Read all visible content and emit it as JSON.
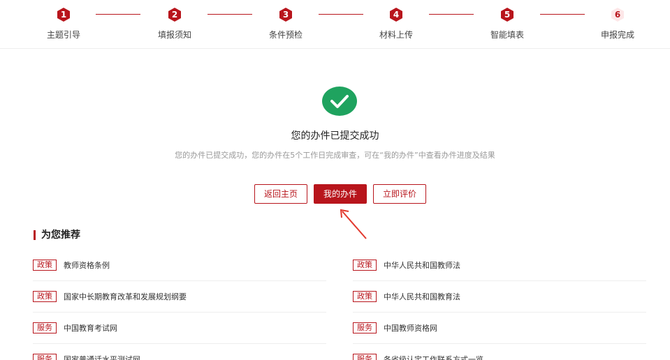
{
  "steps": [
    {
      "number": "1",
      "label": "主题引导"
    },
    {
      "number": "2",
      "label": "填报须知"
    },
    {
      "number": "3",
      "label": "条件预检"
    },
    {
      "number": "4",
      "label": "材料上传"
    },
    {
      "number": "5",
      "label": "智能填表"
    },
    {
      "number": "6",
      "label": "申报完成"
    }
  ],
  "success": {
    "icon": "check-circle-icon",
    "title": "您的办件已提交成功",
    "description": "您的办件已提交成功，您的办件在5个工作日完成审查，可在“我的办件”中查看办件进度及结果"
  },
  "buttons": {
    "home": "返回主页",
    "my_items": "我的办件",
    "evaluate": "立即评价"
  },
  "recommend": {
    "title": "为您推荐",
    "left": [
      {
        "tag": "政策",
        "text": "教师资格条例"
      },
      {
        "tag": "政策",
        "text": "国家中长期教育改革和发展规划纲要"
      },
      {
        "tag": "服务",
        "text": "中国教育考试网"
      },
      {
        "tag": "服务",
        "text": "国家普通话水平测试网"
      }
    ],
    "right": [
      {
        "tag": "政策",
        "text": "中华人民共和国教师法"
      },
      {
        "tag": "政策",
        "text": "中华人民共和国教育法"
      },
      {
        "tag": "服务",
        "text": "中国教师资格网"
      },
      {
        "tag": "服务",
        "text": "各省级认定工作联系方式一览"
      }
    ]
  },
  "colors": {
    "accent": "#b8151c",
    "success": "#1fa35f"
  }
}
